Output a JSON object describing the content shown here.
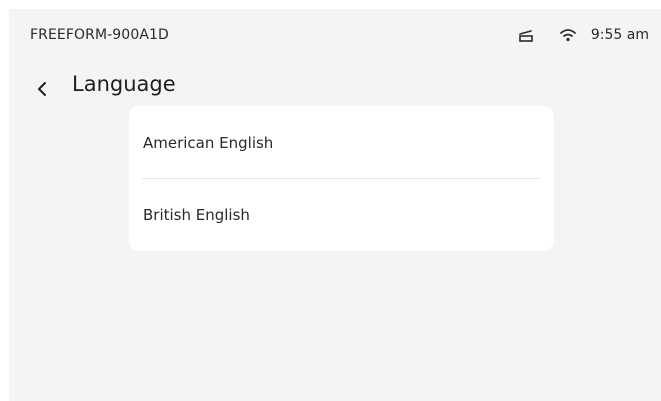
{
  "status_bar": {
    "device_name": "FREEFORM-900A1D",
    "sensor_icon": "tray-icon",
    "wifi_icon": "wifi-icon",
    "time": "9:55 am"
  },
  "header": {
    "back_icon": "chevron-left-icon",
    "title": "Language"
  },
  "languages": {
    "items": [
      {
        "label": "American English"
      },
      {
        "label": "British English"
      }
    ]
  },
  "colors": {
    "background": "#f4f4f4",
    "card": "#ffffff",
    "text": "#202020",
    "divider": "#e8e8e8"
  }
}
